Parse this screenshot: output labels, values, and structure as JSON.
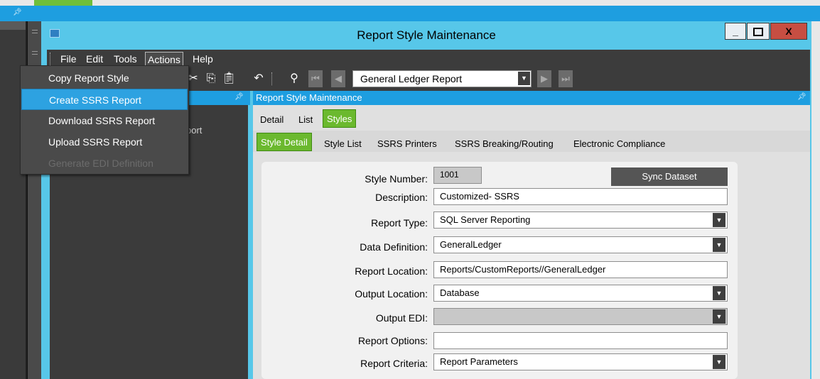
{
  "window": {
    "title": "Report Style Maintenance"
  },
  "window_buttons": {
    "minimize": "_",
    "maximize": "□",
    "close": "X"
  },
  "menubar": {
    "items": [
      "File",
      "Edit",
      "Tools",
      "Actions",
      "Help"
    ]
  },
  "actions_menu": {
    "items": [
      {
        "label": "Copy Report Style",
        "enabled": true
      },
      {
        "label": "Create SSRS Report",
        "enabled": true,
        "highlighted": true
      },
      {
        "label": "Download SSRS Report",
        "enabled": true
      },
      {
        "label": "Upload SSRS Report",
        "enabled": true
      },
      {
        "label": "Generate EDI Definition",
        "enabled": false
      }
    ]
  },
  "toolbar": {
    "report_selector_value": "General Ledger Report"
  },
  "tree_panel": {
    "partial_item_text": "port"
  },
  "main_panel": {
    "header": "Report Style Maintenance"
  },
  "tabs": [
    "Detail",
    "List",
    "Styles"
  ],
  "sub_tabs": [
    "Style Detail",
    "Style List",
    "SSRS Printers",
    "SSRS Breaking/Routing",
    "Electronic Compliance"
  ],
  "form": {
    "style_number": {
      "label": "Style Number:",
      "value": "1001"
    },
    "sync_button": "Sync Dataset",
    "description": {
      "label": "Description:",
      "value": "Customized- SSRS"
    },
    "report_type": {
      "label": "Report Type:",
      "value": "SQL Server Reporting"
    },
    "data_definition": {
      "label": "Data Definition:",
      "value": "GeneralLedger"
    },
    "report_location": {
      "label": "Report Location:",
      "value": "Reports/CustomReports//GeneralLedger"
    },
    "output_location": {
      "label": "Output Location:",
      "value": "Database"
    },
    "output_edi": {
      "label": "Output EDI:",
      "value": ""
    },
    "report_options": {
      "label": "Report Options:",
      "value": ""
    },
    "report_criteria": {
      "label": "Report Criteria:",
      "value": "Report Parameters"
    }
  },
  "colors": {
    "accent_blue": "#1e9ee0",
    "title_blue": "#57c7e9",
    "tab_green": "#6bb92e",
    "menu_dark": "#3c3c3c"
  }
}
